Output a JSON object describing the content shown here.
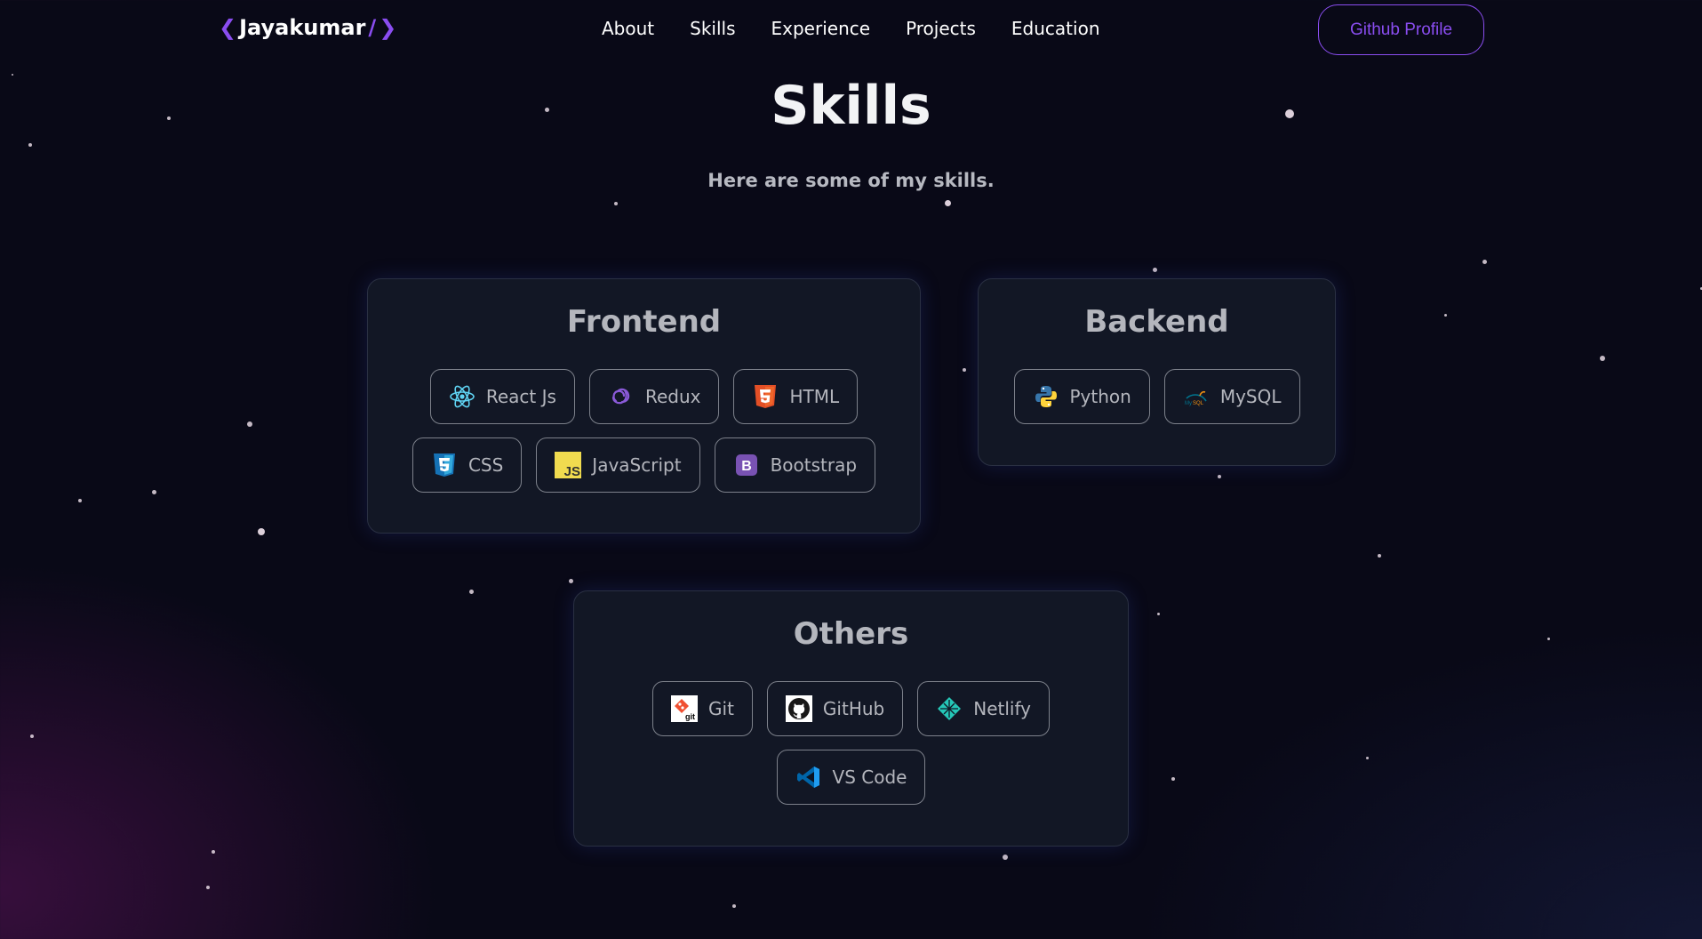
{
  "nav": {
    "logo_text": "Jayakumar",
    "logo_slash": "/",
    "links": [
      "About",
      "Skills",
      "Experience",
      "Projects",
      "Education"
    ],
    "github_button": "Github Profile"
  },
  "header": {
    "title": "Skills",
    "subtitle": "Here are some of my skills."
  },
  "skills": {
    "frontend": {
      "title": "Frontend",
      "items": [
        {
          "label": "React Js",
          "icon": "react-icon"
        },
        {
          "label": "Redux",
          "icon": "redux-icon"
        },
        {
          "label": "HTML",
          "icon": "html5-icon"
        },
        {
          "label": "CSS",
          "icon": "css3-icon"
        },
        {
          "label": "JavaScript",
          "icon": "javascript-icon"
        },
        {
          "label": "Bootstrap",
          "icon": "bootstrap-icon"
        }
      ]
    },
    "backend": {
      "title": "Backend",
      "items": [
        {
          "label": "Python",
          "icon": "python-icon"
        },
        {
          "label": "MySQL",
          "icon": "mysql-icon"
        }
      ]
    },
    "others": {
      "title": "Others",
      "items": [
        {
          "label": "Git",
          "icon": "git-icon"
        },
        {
          "label": "GitHub",
          "icon": "github-icon"
        },
        {
          "label": "Netlify",
          "icon": "netlify-icon"
        },
        {
          "label": "VS Code",
          "icon": "vscode-icon"
        }
      ]
    }
  },
  "colors": {
    "accent": "#8a4df0",
    "background": "#090917",
    "card": "#121725",
    "chip_text": "#b4b6bd"
  }
}
